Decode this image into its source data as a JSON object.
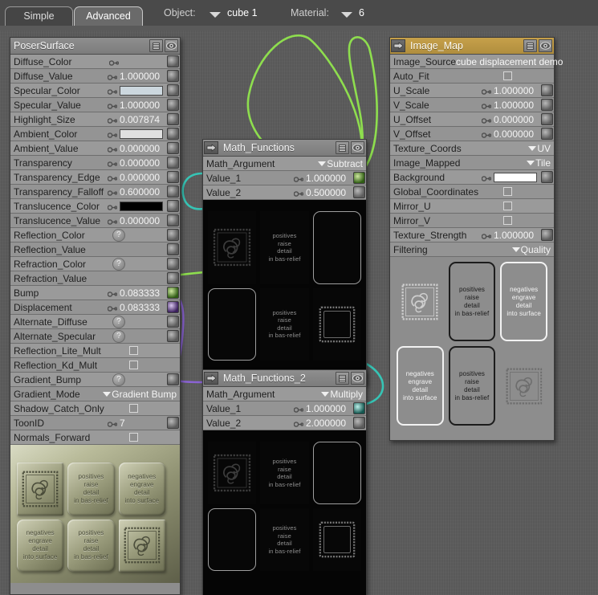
{
  "toolbar": {
    "tabs": [
      {
        "label": "Simple",
        "active": false
      },
      {
        "label": "Advanced",
        "active": true
      }
    ],
    "object_label": "Object:",
    "object_value": "cube 1",
    "material_label": "Material:",
    "material_value": "6"
  },
  "nodes": {
    "poser_surface": {
      "title": "PoserSurface",
      "header_icons": [
        "list-icon",
        "eye-icon"
      ],
      "rows": [
        {
          "label": "Diffuse_Color",
          "type": "socket",
          "value": ""
        },
        {
          "label": "Diffuse_Value",
          "type": "number",
          "value": "1.000000"
        },
        {
          "label": "Specular_Color",
          "type": "swatch",
          "value": "",
          "color": "#ccd7de"
        },
        {
          "label": "Specular_Value",
          "type": "number",
          "value": "1.000000"
        },
        {
          "label": "Highlight_Size",
          "type": "number",
          "value": "0.007874"
        },
        {
          "label": "Ambient_Color",
          "type": "swatch",
          "value": "",
          "color": "#e0e0e0"
        },
        {
          "label": "Ambient_Value",
          "type": "number",
          "value": "0.000000"
        },
        {
          "label": "Transparency",
          "type": "number",
          "value": "0.000000"
        },
        {
          "label": "Transparency_Edge",
          "type": "number",
          "value": "0.000000"
        },
        {
          "label": "Transparency_Falloff",
          "type": "number",
          "value": "0.600000"
        },
        {
          "label": "Translucence_Color",
          "type": "swatch",
          "value": "",
          "color": "#000000"
        },
        {
          "label": "Translucence_Value",
          "type": "number",
          "value": "0.000000"
        },
        {
          "label": "Reflection_Color",
          "type": "question",
          "value": ""
        },
        {
          "label": "Reflection_Value",
          "type": "empty",
          "value": ""
        },
        {
          "label": "Refraction_Color",
          "type": "question",
          "value": ""
        },
        {
          "label": "Refraction_Value",
          "type": "empty",
          "value": ""
        },
        {
          "label": "Bump",
          "type": "number",
          "value": "0.083333",
          "plug": "green"
        },
        {
          "label": "Displacement",
          "type": "number",
          "value": "0.083333",
          "plug": "purple"
        },
        {
          "label": "Alternate_Diffuse",
          "type": "question",
          "value": ""
        },
        {
          "label": "Alternate_Specular",
          "type": "question",
          "value": ""
        },
        {
          "label": "Reflection_Lite_Mult",
          "type": "check",
          "value": "",
          "noplug": true
        },
        {
          "label": "Reflection_Kd_Mult",
          "type": "check",
          "value": "",
          "noplug": true
        },
        {
          "label": "Gradient_Bump",
          "type": "question",
          "value": ""
        },
        {
          "label": "Gradient_Mode",
          "type": "menu",
          "value": "Gradient Bump",
          "noplug": true
        },
        {
          "label": "Shadow_Catch_Only",
          "type": "check",
          "value": "",
          "noplug": true
        },
        {
          "label": "ToonID",
          "type": "number",
          "value": "7"
        },
        {
          "label": "Normals_Forward",
          "type": "check",
          "value": "",
          "noplug": true
        }
      ],
      "preview_tiles": [
        {
          "text": "",
          "art": "knot",
          "style": "raised"
        },
        {
          "text": "positives\nraise\ndetail\nin bas-relief",
          "art": "text",
          "style": "raised"
        },
        {
          "text": "negatives\nengrave\ndetail\ninto surface",
          "art": "text",
          "style": "engraved"
        },
        {
          "text": "negatives\nengrave\ndetail\ninto surface",
          "art": "text",
          "style": "engraved"
        },
        {
          "text": "positives\nraise\ndetail\nin bas-relief",
          "art": "text",
          "style": "raised"
        },
        {
          "text": "",
          "art": "knot",
          "style": "engraved"
        }
      ]
    },
    "math_functions": {
      "title": "Math_Functions",
      "header_icons": [
        "plug-icon",
        "list-icon",
        "eye-icon"
      ],
      "rows": [
        {
          "label": "Math_Argument",
          "type": "menu",
          "value": "Subtract",
          "noplug": true
        },
        {
          "label": "Value_1",
          "type": "number",
          "value": "1.000000",
          "plug": "green"
        },
        {
          "label": "Value_2",
          "type": "number",
          "value": "0.500000"
        }
      ],
      "preview_tiles": [
        {
          "text": "",
          "art": "knot",
          "style": "dark"
        },
        {
          "text": "positives\nraise\ndetail\nin bas-relief",
          "art": "text",
          "style": "dark"
        },
        {
          "text": "",
          "art": "square",
          "style": "dark"
        },
        {
          "text": "",
          "art": "square",
          "style": "dark"
        },
        {
          "text": "positives\nraise\ndetail\nin bas-relief",
          "art": "text",
          "style": "dark"
        },
        {
          "text": "",
          "art": "frame",
          "style": "dark"
        }
      ]
    },
    "math_functions_2": {
      "title": "Math_Functions_2",
      "header_icons": [
        "plug-icon",
        "list-icon",
        "eye-icon"
      ],
      "rows": [
        {
          "label": "Math_Argument",
          "type": "menu",
          "value": "Multiply",
          "noplug": true
        },
        {
          "label": "Value_1",
          "type": "number",
          "value": "1.000000",
          "plug": "cyan"
        },
        {
          "label": "Value_2",
          "type": "number",
          "value": "2.000000"
        }
      ],
      "preview_tiles": [
        {
          "text": "",
          "art": "knot",
          "style": "dark"
        },
        {
          "text": "positives\nraise\ndetail\nin bas-relief",
          "art": "text",
          "style": "dark"
        },
        {
          "text": "",
          "art": "square",
          "style": "dark"
        },
        {
          "text": "",
          "art": "square",
          "style": "dark"
        },
        {
          "text": "positives\nraise\ndetail\nin bas-relief",
          "art": "text",
          "style": "dark"
        },
        {
          "text": "",
          "art": "frame",
          "style": "dark"
        }
      ]
    },
    "image_map": {
      "title": "Image_Map",
      "header_icons": [
        "plug-icon",
        "list-icon",
        "eye-icon"
      ],
      "rows": [
        {
          "label": "Image_Source",
          "type": "text",
          "value": "cube displacement demo",
          "noplug": true
        },
        {
          "label": "Auto_Fit",
          "type": "check",
          "value": "",
          "noplug": true
        },
        {
          "label": "U_Scale",
          "type": "number",
          "value": "1.000000"
        },
        {
          "label": "V_Scale",
          "type": "number",
          "value": "1.000000"
        },
        {
          "label": "U_Offset",
          "type": "number",
          "value": "0.000000"
        },
        {
          "label": "V_Offset",
          "type": "number",
          "value": "0.000000"
        },
        {
          "label": "Texture_Coords",
          "type": "menu",
          "value": "UV",
          "noplug": true
        },
        {
          "label": "Image_Mapped",
          "type": "menu",
          "value": "Tile",
          "noplug": true
        },
        {
          "label": "Background",
          "type": "swatch",
          "value": "",
          "color": "#ffffff"
        },
        {
          "label": "Global_Coordinates",
          "type": "check",
          "value": "",
          "noplug": true
        },
        {
          "label": "Mirror_U",
          "type": "check",
          "value": "",
          "noplug": true
        },
        {
          "label": "Mirror_V",
          "type": "check",
          "value": "",
          "noplug": true
        },
        {
          "label": "Texture_Strength",
          "type": "number",
          "value": "1.000000"
        },
        {
          "label": "Filtering",
          "type": "menu",
          "value": "Quality",
          "noplug": true
        }
      ],
      "preview_tiles": [
        {
          "text": "",
          "art": "knot",
          "style": "flat"
        },
        {
          "text": "positives\nraise\ndetail\nin bas-relief",
          "art": "text",
          "style": "black"
        },
        {
          "text": "negatives\nengrave\ndetail\ninto surface",
          "art": "text",
          "style": "white"
        },
        {
          "text": "negatives\nengrave\ndetail\ninto surface",
          "art": "text",
          "style": "white"
        },
        {
          "text": "positives\nraise\ndetail\nin bas-relief",
          "art": "text",
          "style": "black"
        },
        {
          "text": "",
          "art": "knot",
          "style": "flat"
        }
      ]
    }
  },
  "wires": [
    {
      "name": "bump-to-math-functions",
      "color": "#8ede4e"
    },
    {
      "name": "displacement-to-math-2",
      "color": "#8a63d2"
    },
    {
      "name": "math-value1-to-image-map",
      "color": "#8ede4e"
    },
    {
      "name": "math-value1-to-image-map-2",
      "color": "#8ede4e"
    },
    {
      "name": "math2-out-to-math-input",
      "color": "#36c4b5"
    },
    {
      "name": "math-input-loop",
      "color": "#36c4b5"
    }
  ],
  "colors": {
    "canvas_bg": "#5c5c5c",
    "node_bg": "#8d8d8d",
    "gold_header": "#c6a04a",
    "wire_green": "#8ede4e",
    "wire_purple": "#8a63d2",
    "wire_cyan": "#36c4b5"
  }
}
